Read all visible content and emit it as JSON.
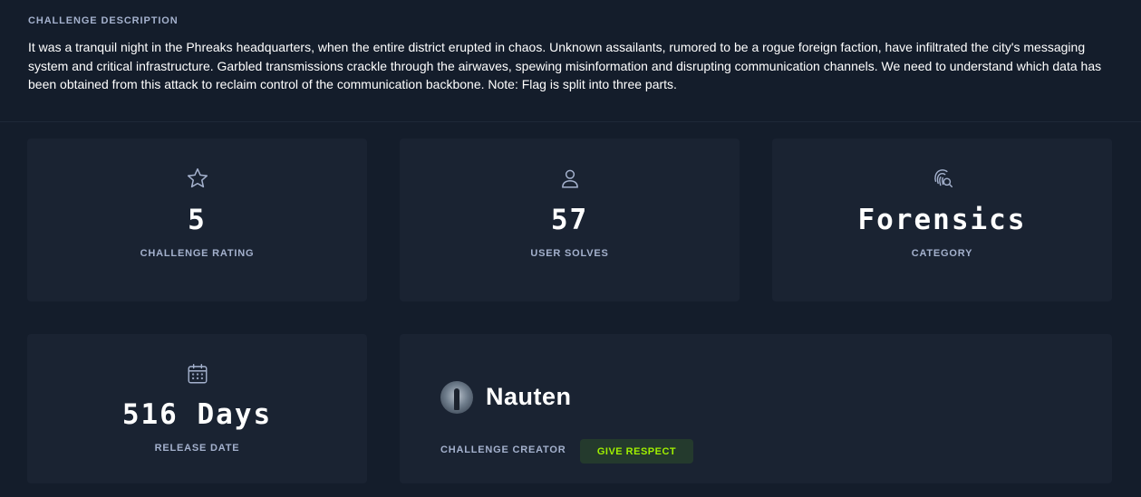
{
  "description": {
    "heading": "CHALLENGE DESCRIPTION",
    "text": "It was a tranquil night in the Phreaks headquarters, when the entire district erupted in chaos. Unknown assailants, rumored to be a rogue foreign faction, have infiltrated the city's messaging system and critical infrastructure. Garbled transmissions crackle through the airwaves, spewing misinformation and disrupting communication channels. We need to understand which data has been obtained from this attack to reclaim control of the communication backbone. Note: Flag is split into three parts."
  },
  "stats": {
    "rating": {
      "icon": "star-icon",
      "value": "5",
      "label": "CHALLENGE RATING"
    },
    "solves": {
      "icon": "user-icon",
      "value": "57",
      "label": "USER SOLVES"
    },
    "category": {
      "icon": "fingerprint-search-icon",
      "value": "Forensics",
      "label": "CATEGORY"
    },
    "release": {
      "icon": "calendar-icon",
      "value": "516 Days",
      "label": "RELEASE DATE"
    }
  },
  "creator": {
    "name": "Nauten",
    "label": "CHALLENGE CREATOR",
    "respect_label": "GIVE RESPECT"
  },
  "colors": {
    "background": "#141d2b",
    "card": "#1a2332",
    "muted_text": "#a4b1cd",
    "accent_green": "#9fef00"
  }
}
